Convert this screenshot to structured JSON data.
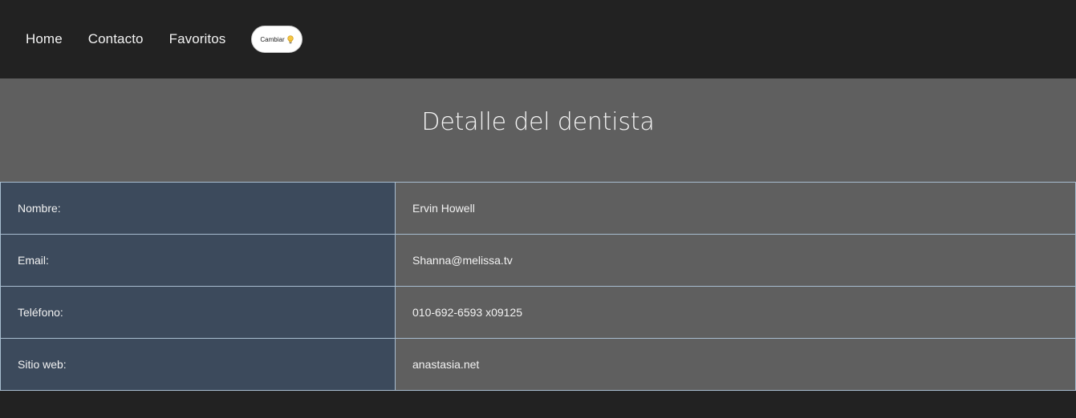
{
  "nav": {
    "links": [
      "Home",
      "Contacto",
      "Favoritos"
    ],
    "theme_button_label": "Cambiar"
  },
  "page": {
    "title": "Detalle del dentista"
  },
  "detail": {
    "rows": [
      {
        "label": "Nombre:",
        "value": "Ervin Howell"
      },
      {
        "label": "Email:",
        "value": "Shanna@melissa.tv"
      },
      {
        "label": "Teléfono:",
        "value": "010-692-6593 x09125"
      },
      {
        "label": "Sitio web:",
        "value": "anastasia.net"
      }
    ]
  },
  "icons": {
    "theme_button_icon": "lightbulb-icon"
  },
  "colors": {
    "nav_background": "#222222",
    "section_background": "#5f5f5f",
    "label_cell_background": "#3c4a5c",
    "border": "#a8bdd0",
    "bulb": "#f5c542"
  }
}
